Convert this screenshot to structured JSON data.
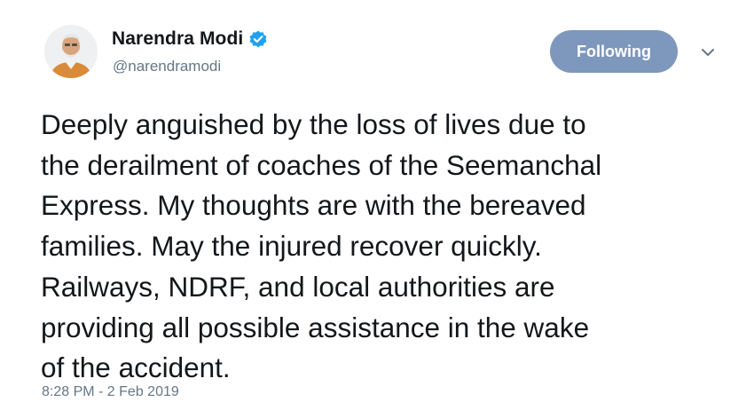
{
  "author": {
    "display_name": "Narendra Modi",
    "handle": "@narendramodi",
    "verified": true,
    "avatar_icon": "profile-photo"
  },
  "actions": {
    "follow_label": "Following",
    "menu_icon": "chevron-down-icon"
  },
  "tweet": {
    "lines": [
      "Deeply anguished by the loss of lives due to",
      "the derailment of coaches of the Seemanchal",
      "Express. My thoughts are with the bereaved",
      "families. May the injured recover quickly.",
      "Railways, NDRF, and local authorities are",
      "providing all possible assistance in the wake",
      "of the accident."
    ],
    "timestamp": "8:28 PM - 2 Feb 2019"
  },
  "colors": {
    "follow_button": "#7e97bd",
    "verified_badge": "#1da1f2",
    "secondary_text": "#657786"
  }
}
